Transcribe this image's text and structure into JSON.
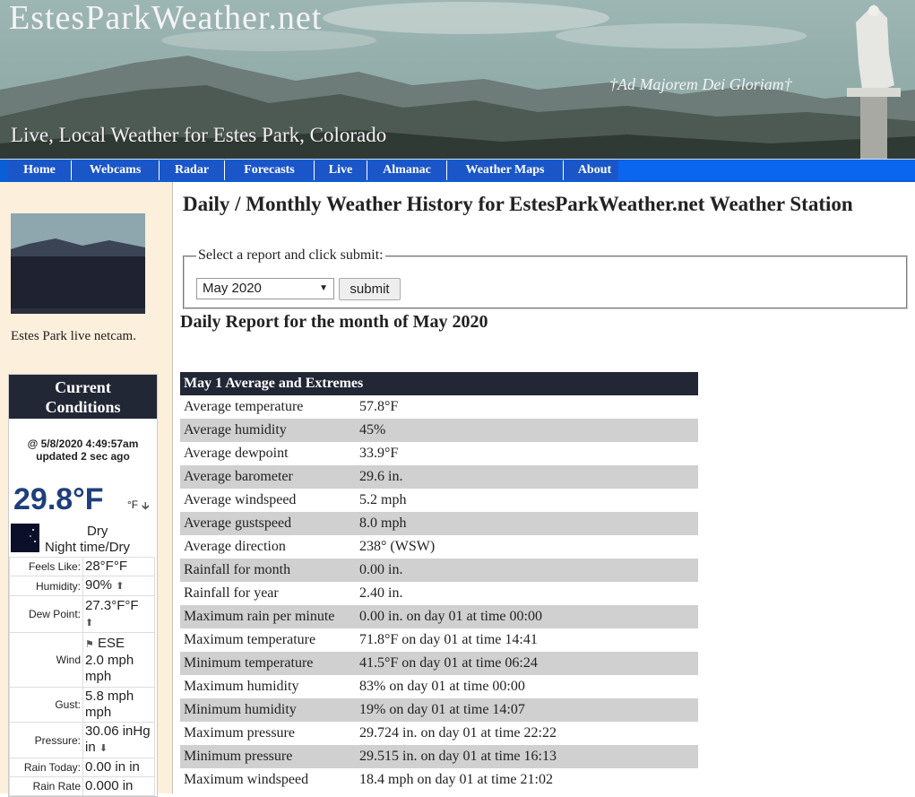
{
  "header": {
    "site_title": "EstesParkWeather.net",
    "tagline": "Live, Local Weather for Estes Park, Colorado",
    "motto": "†Ad Majorem Dei Gloriam†"
  },
  "nav": {
    "items": [
      {
        "label": "Home"
      },
      {
        "label": "Webcams"
      },
      {
        "label": "Radar"
      },
      {
        "label": "Forecasts"
      },
      {
        "label": "Live"
      },
      {
        "label": "Almanac"
      },
      {
        "label": "Weather Maps"
      },
      {
        "label": "About"
      }
    ]
  },
  "sidebar": {
    "netcam_caption_prefix": "Estes Park ",
    "netcam_caption_link": "live netcam.",
    "current_conditions": {
      "title_line1": "Current",
      "title_line2": "Conditions",
      "timestamp": "@ 5/8/2020 4:49:57am",
      "updated": "updated 2 sec ago",
      "temperature": "29.8°F",
      "temp_unit": "°F",
      "condition_line1": "Dry",
      "condition_line2": "Night time/Dry",
      "icons": [
        "moon-icon",
        "arrow-down-icon",
        "arrow-up-icon",
        "wind-direction-icon"
      ],
      "rows": [
        {
          "label": "Feels Like:",
          "value": "28°F°F"
        },
        {
          "label": "Humidity:",
          "value": "90%"
        },
        {
          "label": "Dew Point:",
          "value": "27.3°F°F"
        },
        {
          "label": "Wind",
          "dir": "ESE",
          "value": "2.0 mph mph"
        },
        {
          "label": "Gust:",
          "value": "5.8 mph mph"
        },
        {
          "label": "Pressure:",
          "value": "30.06 inHg in"
        },
        {
          "label": "Rain Today:",
          "value": "0.00 in in"
        },
        {
          "label": "Rain Rate",
          "value": "0.000 in"
        }
      ]
    }
  },
  "main": {
    "page_title": "Daily / Monthly Weather History for EstesParkWeather.net Weather Station",
    "form": {
      "legend": "Select a report and click submit:",
      "selected_month": "May 2020",
      "submit_label": "submit"
    },
    "report_heading": "Daily Report for the month of May 2020",
    "table": {
      "header": "May 1 Average and Extremes",
      "rows": [
        {
          "k": "Average temperature",
          "v": "57.8°F"
        },
        {
          "k": "Average humidity",
          "v": "45%"
        },
        {
          "k": "Average dewpoint",
          "v": "33.9°F"
        },
        {
          "k": "Average barometer",
          "v": "29.6 in."
        },
        {
          "k": "Average windspeed",
          "v": "5.2 mph"
        },
        {
          "k": "Average gustspeed",
          "v": "8.0 mph"
        },
        {
          "k": "Average direction",
          "v": "238° (WSW)"
        },
        {
          "k": "Rainfall for month",
          "v": "0.00 in."
        },
        {
          "k": "Rainfall for year",
          "v": "2.40 in."
        },
        {
          "k": "Maximum rain per minute",
          "v": "0.00 in. on day 01 at time 00:00"
        },
        {
          "k": "Maximum temperature",
          "v": "71.8°F on day 01 at time 14:41"
        },
        {
          "k": "Minimum temperature",
          "v": "41.5°F on day 01 at time 06:24"
        },
        {
          "k": "Maximum humidity",
          "v": "83% on day 01 at time 00:00"
        },
        {
          "k": "Minimum humidity",
          "v": "19% on day 01 at time 14:07"
        },
        {
          "k": "Maximum pressure",
          "v": "29.724 in. on day 01 at time 22:22"
        },
        {
          "k": "Minimum pressure",
          "v": "29.515 in. on day 01 at time 16:13"
        },
        {
          "k": "Maximum windspeed",
          "v": "18.4 mph on day 01 at time 21:02"
        }
      ]
    }
  }
}
